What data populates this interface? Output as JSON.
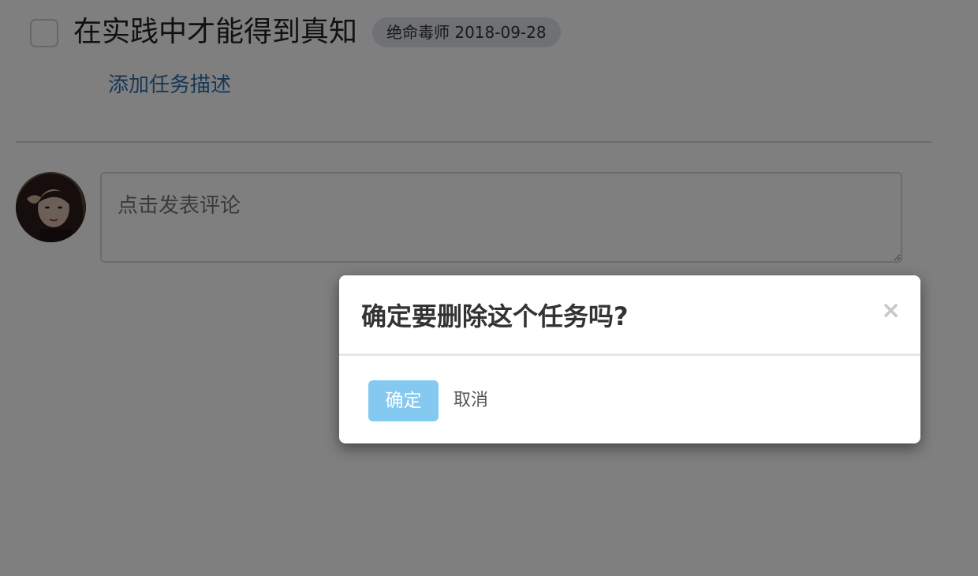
{
  "task": {
    "title": "在实践中才能得到真知",
    "meta": "绝命毒师 2018-09-28",
    "add_description": "添加任务描述"
  },
  "comment": {
    "placeholder": "点击发表评论"
  },
  "dialog": {
    "title": "确定要删除这个任务吗?",
    "close_symbol": "×",
    "confirm_label": "确定",
    "cancel_label": "取消",
    "confirm_color": "#84c9ef"
  },
  "icons": {
    "avatar": "avatar-photo-icon",
    "close": "close-icon"
  }
}
